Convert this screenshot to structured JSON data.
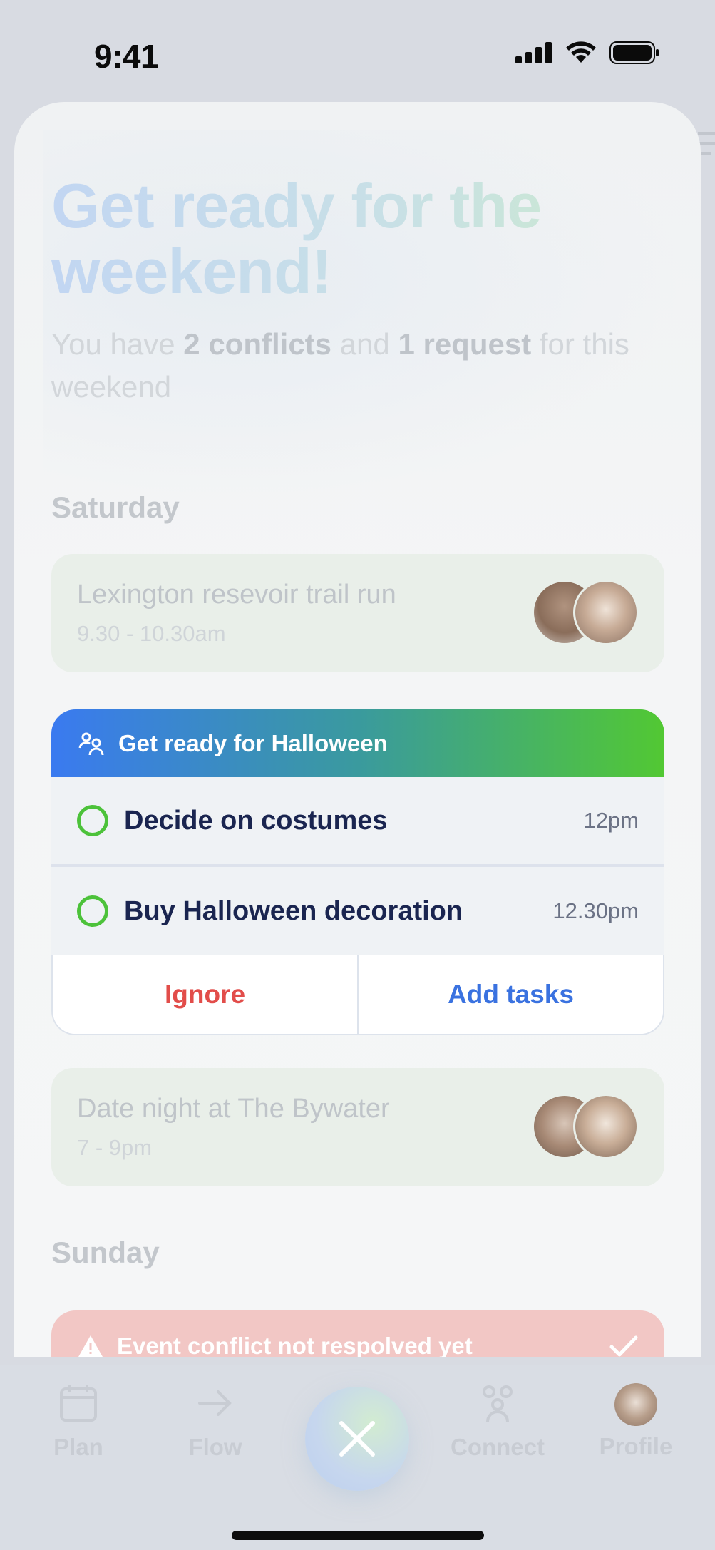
{
  "status_bar": {
    "time": "9:41",
    "icons": [
      "signal-icon",
      "wifi-icon",
      "battery-icon"
    ]
  },
  "hero": {
    "title": "Get ready for the weekend!",
    "subtitle_prefix": "You have ",
    "conflicts": "2 conflicts",
    "subtitle_mid": " and ",
    "requests": "1 request",
    "subtitle_suffix": " for this weekend"
  },
  "days": {
    "saturday": "Saturday",
    "sunday": "Sunday"
  },
  "events": [
    {
      "title": "Lexington resevoir trail run",
      "time": "9.30 - 10.30am"
    },
    {
      "title": "Date night at The Bywater",
      "time": "7 - 9pm"
    }
  ],
  "suggestion": {
    "title": "Get ready for Halloween",
    "icon": "people-icon",
    "tasks": [
      {
        "label": "Decide on costumes",
        "time": "12pm"
      },
      {
        "label": "Buy Halloween decoration",
        "time": "12.30pm"
      }
    ],
    "ignore_label": "Ignore",
    "add_label": "Add tasks"
  },
  "conflict": {
    "text": "Event conflict not respolved yet",
    "icon": "warning-icon"
  },
  "tabbar": {
    "items": [
      {
        "label": "Plan",
        "icon": "calendar-icon"
      },
      {
        "label": "Flow",
        "icon": "arrow-right-icon"
      },
      {
        "label": "Connect",
        "icon": "people-icon"
      },
      {
        "label": "Profile",
        "icon": "avatar"
      }
    ],
    "close_icon": "close-icon"
  },
  "colors": {
    "accent_blue": "#3a7af0",
    "accent_green": "#52c833",
    "danger": "#e24d4a",
    "text_dark": "#1a2550"
  }
}
